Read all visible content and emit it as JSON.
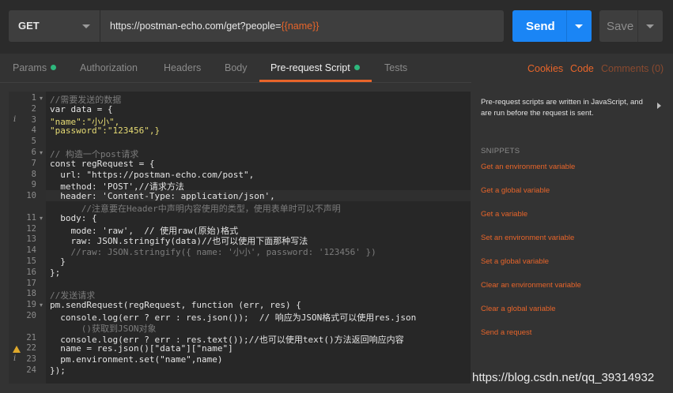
{
  "request": {
    "method": "GET",
    "url_prefix": "https://postman-echo.com/get?people=",
    "url_var": "{{name}}",
    "send_label": "Send",
    "save_label": "Save"
  },
  "tabs": [
    {
      "label": "Params",
      "dot": true
    },
    {
      "label": "Authorization"
    },
    {
      "label": "Headers"
    },
    {
      "label": "Body"
    },
    {
      "label": "Pre-request Script",
      "dot": true,
      "active": true
    },
    {
      "label": "Tests"
    }
  ],
  "right_links": {
    "cookies": "Cookies",
    "code": "Code",
    "comments": "Comments (0)"
  },
  "accent_color": "#e8652a",
  "sidebar": {
    "description": "Pre-request scripts are written in JavaScript, and are run before the request is sent.",
    "snippets_header": "SNIPPETS",
    "snippets": [
      "Get an environment variable",
      "Get a global variable",
      "Get a variable",
      "Set an environment variable",
      "Set a global variable",
      "Clear an environment variable",
      "Clear a global variable",
      "Send a request"
    ]
  },
  "editor": {
    "line_numbers": [
      "1",
      "2",
      "3",
      "4",
      "5",
      "6",
      "7",
      "8",
      "9",
      "10",
      "",
      "11",
      "12",
      "13",
      "14",
      "15",
      "16",
      "17",
      "18",
      "19",
      "20",
      "",
      "21",
      "22",
      "23",
      "24"
    ],
    "lines": [
      "//需要发送的数据",
      "var data = {",
      "\"name\":\"小小\",",
      "\"password\":\"123456\",}",
      "",
      "// 构造一个post请求",
      "const regRequest = {",
      "  url: \"https://postman-echo.com/post\",",
      "  method: 'POST',//请求方法",
      "  header: 'Content-Type: application/json',",
      "      //注意要在Header中声明内容使用的类型，使用表单时可以不声明",
      "  body: {",
      "    mode: 'raw',  // 使用raw(原始)格式",
      "    raw: JSON.stringify(data)//也可以使用下面那种写法",
      "    //raw: JSON.stringify({ name: '小小', password: '123456' })",
      "  }",
      "};",
      "",
      "//发送请求",
      "pm.sendRequest(regRequest, function (err, res) {",
      "  console.log(err ? err : res.json());  // 响应为JSON格式可以使用res.json",
      "      ()获取到JSON对象",
      "  console.log(err ? err : res.text());//也可以使用text()方法返回响应内容",
      "  name = res.json()[\"data\"][\"name\"]",
      "  pm.environment.set(\"name\",name)",
      "});"
    ]
  },
  "watermark": "https://blog.csdn.net/qq_39314932"
}
